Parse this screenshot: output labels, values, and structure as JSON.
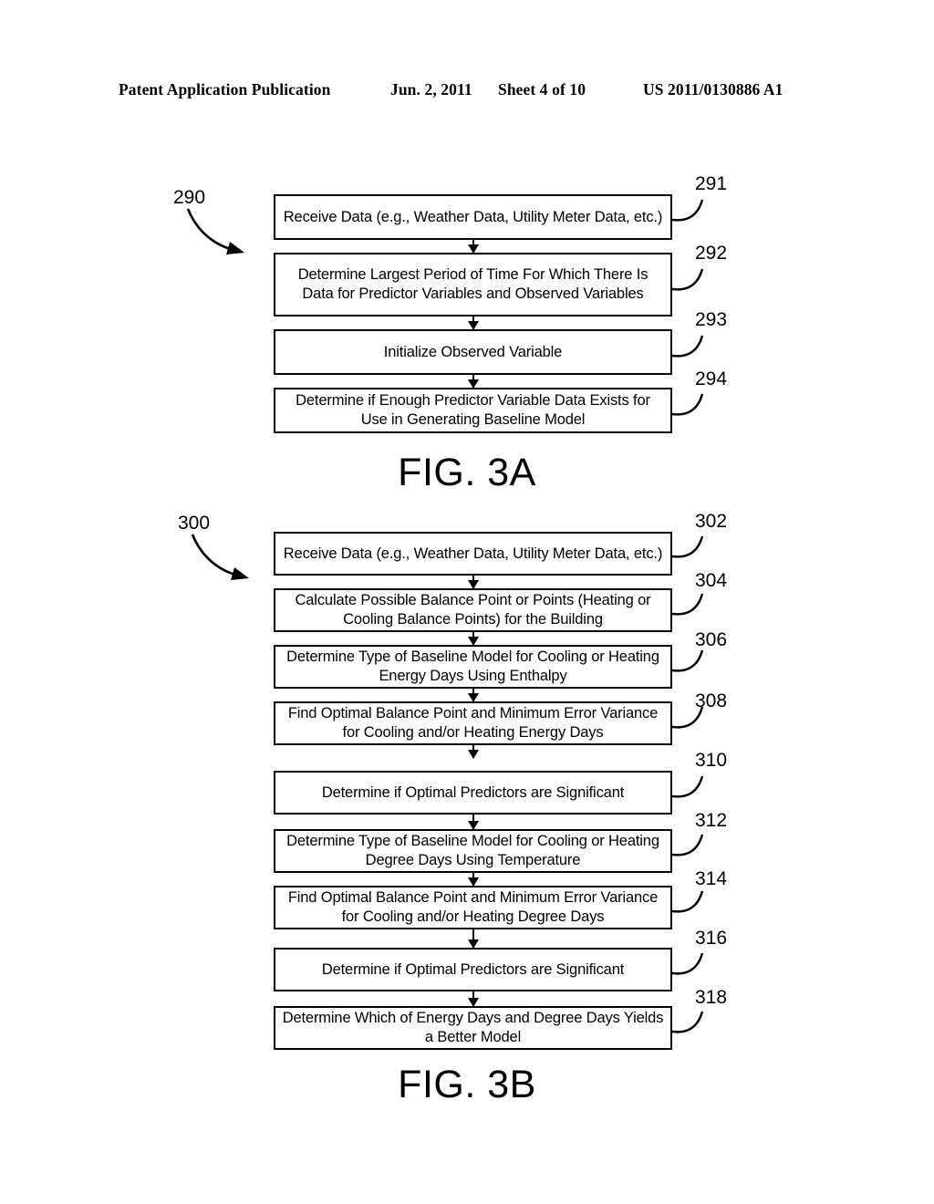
{
  "header": {
    "publication": "Patent Application Publication",
    "date": "Jun. 2, 2011",
    "sheet": "Sheet 4 of 10",
    "patent_number": "US 2011/0130886 A1"
  },
  "figures": [
    {
      "caption": "FIG. 3A",
      "entry_label": "290",
      "boxes": [
        {
          "ref": "291",
          "text": "Receive Data (e.g., Weather Data, Utility Meter Data, etc.)"
        },
        {
          "ref": "292",
          "text": "Determine Largest Period of Time For Which There Is Data for Predictor Variables and Observed Variables"
        },
        {
          "ref": "293",
          "text": "Initialize Observed Variable"
        },
        {
          "ref": "294",
          "text": "Determine if Enough Predictor Variable Data Exists for Use in Generating Baseline Model"
        }
      ]
    },
    {
      "caption": "FIG. 3B",
      "entry_label": "300",
      "boxes": [
        {
          "ref": "302",
          "text": "Receive Data (e.g., Weather Data, Utility Meter Data, etc.)"
        },
        {
          "ref": "304",
          "text": "Calculate Possible Balance Point or Points (Heating or Cooling Balance Points) for the Building"
        },
        {
          "ref": "306",
          "text": "Determine Type of Baseline Model for Cooling or Heating Energy Days Using Enthalpy"
        },
        {
          "ref": "308",
          "text": "Find Optimal Balance Point and Minimum Error Variance for Cooling and/or Heating Energy Days"
        },
        {
          "ref": "310",
          "text": "Determine if Optimal Predictors are Significant"
        },
        {
          "ref": "312",
          "text": "Determine Type of Baseline Model for Cooling or Heating Degree Days Using Temperature"
        },
        {
          "ref": "314",
          "text": "Find Optimal Balance Point and Minimum Error Variance for Cooling and/or Heating Degree Days"
        },
        {
          "ref": "316",
          "text": "Determine if Optimal Predictors are Significant"
        },
        {
          "ref": "318",
          "text": "Determine Which of Energy Days and Degree Days Yields a Better Model"
        }
      ]
    }
  ]
}
